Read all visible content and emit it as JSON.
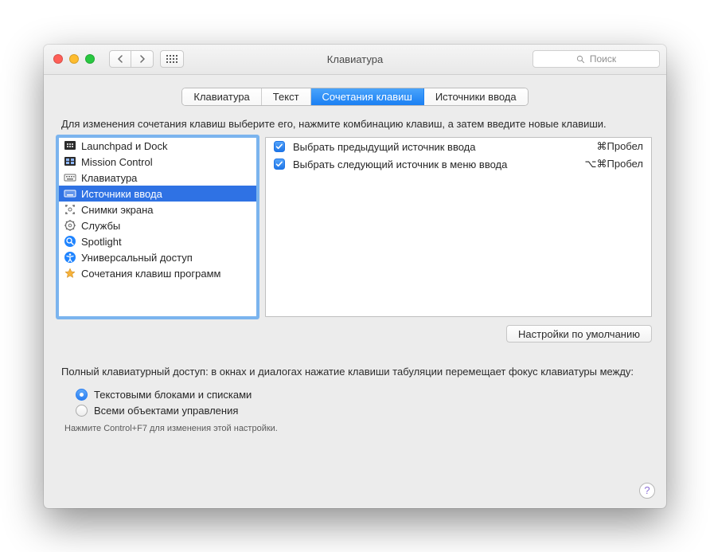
{
  "window_title": "Клавиатура",
  "search_placeholder": "Поиск",
  "tabs": {
    "items": [
      "Клавиатура",
      "Текст",
      "Сочетания клавиш",
      "Источники ввода"
    ],
    "active_index": 2
  },
  "instructions": "Для изменения сочетания клавиш выберите его, нажмите комбинацию клавиш, а затем введите новые клавиши.",
  "categories": {
    "items": [
      {
        "label": "Launchpad и Dock",
        "icon": "launchpad-icon"
      },
      {
        "label": "Mission Control",
        "icon": "mission-control-icon"
      },
      {
        "label": "Клавиатура",
        "icon": "keyboard-icon"
      },
      {
        "label": "Источники ввода",
        "icon": "input-sources-icon"
      },
      {
        "label": "Снимки экрана",
        "icon": "screenshot-icon"
      },
      {
        "label": "Службы",
        "icon": "services-icon"
      },
      {
        "label": "Spotlight",
        "icon": "spotlight-icon"
      },
      {
        "label": "Универсальный доступ",
        "icon": "accessibility-icon"
      },
      {
        "label": "Сочетания клавиш программ",
        "icon": "app-shortcuts-icon"
      }
    ],
    "selected_index": 3
  },
  "shortcuts": {
    "items": [
      {
        "enabled": true,
        "label": "Выбрать предыдущий источник ввода",
        "keys": "⌘Пробел"
      },
      {
        "enabled": true,
        "label": "Выбрать следующий источник в меню ввода",
        "keys": "⌥⌘Пробел"
      }
    ]
  },
  "defaults_button": "Настройки по умолчанию",
  "full_access": {
    "text": "Полный клавиатурный доступ: в окнах и диалогах нажатие клавиши табуляции перемещает фокус клавиатуры между:",
    "options": [
      "Текстовыми блоками и списками",
      "Всеми объектами управления"
    ],
    "selected_index": 0,
    "hint": "Нажмите Control+F7 для изменения этой настройки."
  },
  "help_label": "?"
}
